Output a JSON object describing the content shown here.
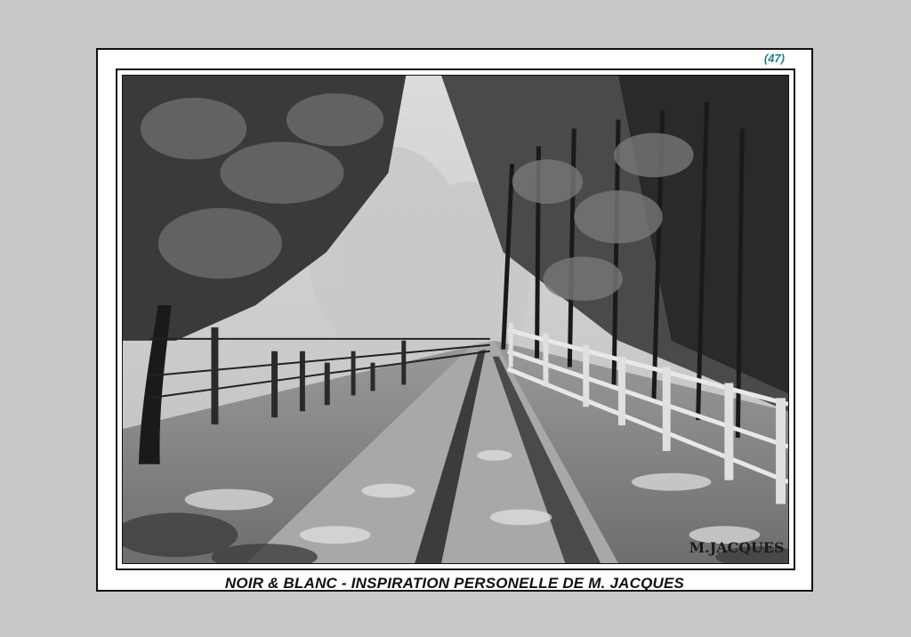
{
  "page_number": "(47)",
  "caption": "NOIR & BLANC - INSPIRATION PERSONELLE DE M. JACQUES",
  "signature": "M.JACQUES",
  "colors": {
    "background": "#c8c8c8",
    "card": "#ffffff",
    "page_number": "#1f7f8f",
    "frame": "#111111"
  }
}
